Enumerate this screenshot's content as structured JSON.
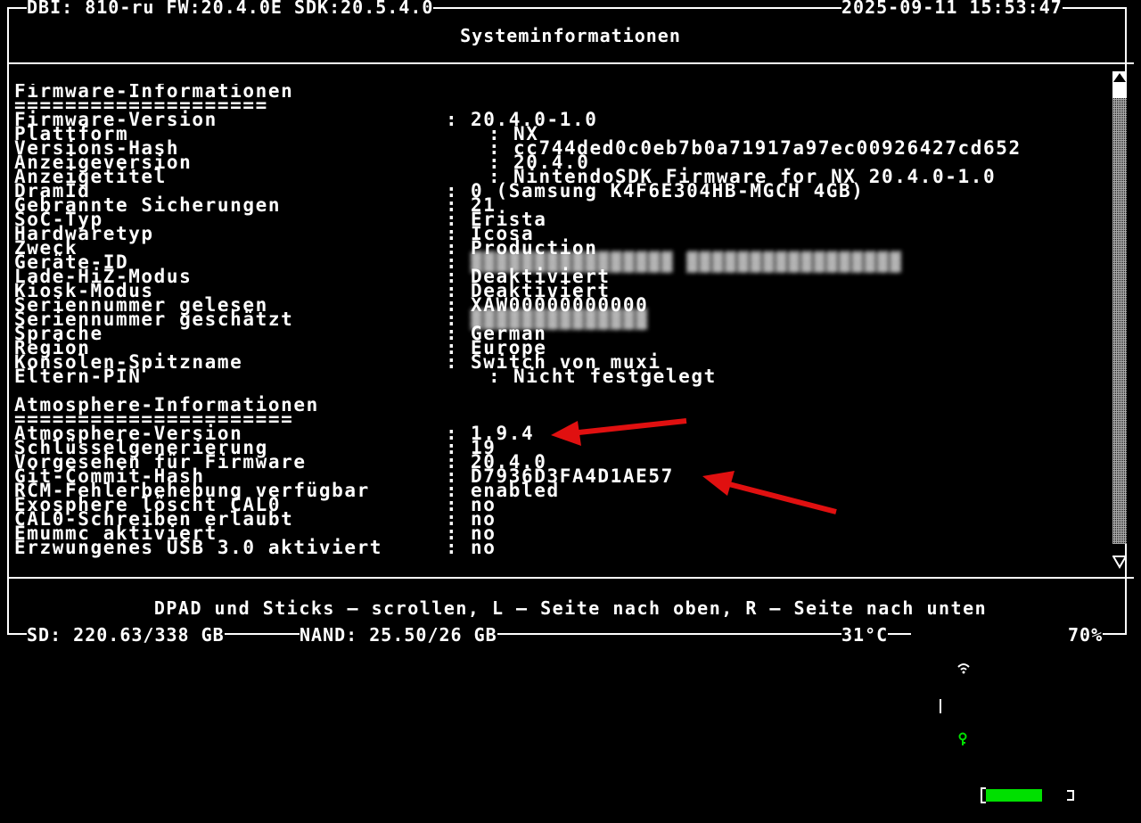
{
  "header": {
    "left": "DBI: 810-ru FW:20.4.0E SDK:20.5.4.0",
    "datetime": "2025-09-11 15:53:47",
    "title": "Systeminformationen"
  },
  "sections": [
    {
      "heading": "Firmware-Informationen",
      "underline": "====================",
      "rows": [
        {
          "key": "Firmware-Version",
          "value": "20.4.0-1.0",
          "alt": false
        },
        {
          "key": "Plattform",
          "value": "NX",
          "alt": true
        },
        {
          "key": "Versions-Hash",
          "value": "cc744ded0c0eb7b0a71917a97ec00926427cd652",
          "alt": true
        },
        {
          "key": "Anzeigeversion",
          "value": "20.4.0",
          "alt": true
        },
        {
          "key": "Anzeigetitel",
          "value": "NintendoSDK Firmware for NX 20.4.0-1.0",
          "alt": true
        },
        {
          "key": "DramId",
          "value": "0 (Samsung K4F6E304HB-MGCH 4GB)",
          "alt": false
        },
        {
          "key": "Gebrannte Sicherungen",
          "value": "21",
          "alt": false
        },
        {
          "key": "SoC-Typ",
          "value": "Erista",
          "alt": false
        },
        {
          "key": "Hardwaretyp",
          "value": "Icosa",
          "alt": false
        },
        {
          "key": "Zweck",
          "value": "Production",
          "alt": false
        },
        {
          "key": "Geräte-ID",
          "value": "",
          "alt": false,
          "blurred": true
        },
        {
          "key": "Lade-HiZ-Modus",
          "value": "Deaktiviert",
          "alt": false
        },
        {
          "key": "Kiosk-Modus",
          "value": "Deaktiviert",
          "alt": false
        },
        {
          "key": "Seriennummer gelesen",
          "value": "XAW00000000000",
          "alt": false
        },
        {
          "key": "Seriennummer geschätzt",
          "value": "",
          "alt": false,
          "blurred": true
        },
        {
          "key": "Sprache",
          "value": "German",
          "alt": false
        },
        {
          "key": "Region",
          "value": "Europe",
          "alt": false
        },
        {
          "key": "Konsolen-Spitzname",
          "value": "Switch von muxi",
          "alt": false
        },
        {
          "key": "Eltern-PIN",
          "value": "Nicht festgelegt",
          "alt": true
        }
      ]
    },
    {
      "heading": "Atmosphere-Informationen",
      "underline": "======================",
      "rows": [
        {
          "key": "Atmosphere-Version",
          "value": "1.9.4",
          "alt": false
        },
        {
          "key": "Schlüsselgenerierung",
          "value": "19",
          "alt": false
        },
        {
          "key": "Vorgesehen für Firmware",
          "value": "20.4.0",
          "alt": false
        },
        {
          "key": "Git-Commit-Hash",
          "value": "D7936D3FA4D1AE57",
          "alt": false
        },
        {
          "key": "RCM-Fehlerbehebung verfügbar",
          "value": "enabled",
          "alt": false
        },
        {
          "key": "Exosphere löscht CAL0",
          "value": "no",
          "alt": false
        },
        {
          "key": "CAL0-Schreiben erlaubt",
          "value": "no",
          "alt": false
        },
        {
          "key": "Emummc aktiviert",
          "value": "no",
          "alt": false
        },
        {
          "key": "Erzwungenes USB 3.0 aktiviert",
          "value": "no",
          "alt": false
        }
      ]
    }
  ],
  "colon": ":",
  "help_text": "DPAD und Sticks — scrollen, L — Seite nach oben, R — Seite nach unten",
  "footer": {
    "sd": "SD: 220.63/338 GB",
    "nand": "NAND: 25.50/26 GB",
    "temperature": "31°C",
    "battery_percent": "70%",
    "battery_level": 0.7
  },
  "colors": {
    "text": "#ffffff",
    "background": "#000000",
    "battery": "#00e000",
    "arrow": "#e01010"
  },
  "icons": [
    "wifi-icon",
    "key-icon",
    "battery-icon",
    "scroll-up-icon",
    "scroll-down-icon"
  ]
}
